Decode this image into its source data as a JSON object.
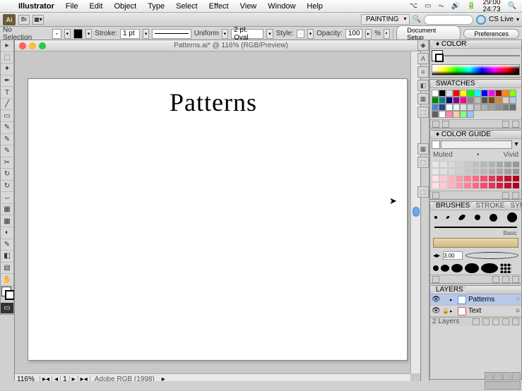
{
  "menubar": {
    "app": "Illustrator",
    "items": [
      "File",
      "Edit",
      "Object",
      "Type",
      "Select",
      "Effect",
      "View",
      "Window",
      "Help"
    ],
    "clock_top": "29:00",
    "clock_bottom": "24:73"
  },
  "appbar": {
    "logo": "Ai",
    "workspace": "PAINTING",
    "cslive": "CS Live"
  },
  "controlbar": {
    "selection": "No Selection",
    "stroke_label": "Stroke:",
    "stroke_value": "1 pt",
    "brush_profile": "Uniform",
    "brush_def": "2 pt. Oval",
    "style_label": "Style:",
    "opacity_label": "Opacity:",
    "opacity_value": "100",
    "pct": "%",
    "doc_setup": "Document Setup",
    "preferences": "Preferences"
  },
  "document": {
    "title": "Patterns.ai* @ 116% (RGB/Preview)",
    "heading": "Patterns",
    "zoom": "116%",
    "page_nav": "1",
    "color_profile": "Adobe RGB (1998)"
  },
  "tools": [
    "▸",
    "⬚",
    "✦",
    "✒",
    "T",
    "╱",
    "▭",
    "✎",
    "✂",
    "↻",
    "▦",
    "◐",
    "◧",
    "▤",
    "⇔",
    "Aa",
    "🔍",
    "✋",
    "⬚"
  ],
  "dock_icons": [
    "◆",
    "A",
    "≡",
    "◧",
    "▦",
    "⬚",
    "⬚",
    "⬚",
    "",
    "▦",
    "⬚"
  ],
  "panels": {
    "color": {
      "tab": "COLOR"
    },
    "swatches": {
      "tab": "SWATCHES",
      "colors": [
        "#ffffff",
        "#000000",
        "#e0e0e0",
        "#ff0000",
        "#ffff00",
        "#00ff00",
        "#00ffff",
        "#0000ff",
        "#ff00ff",
        "#880000",
        "#ff8800",
        "#88ff00",
        "#008800",
        "#008888",
        "#000088",
        "#880088",
        "#ff0088",
        "#888888",
        "#bbbbbb",
        "#555555",
        "#884400",
        "#cc8844",
        "#eeccaa",
        "#aaccee",
        "#4488cc",
        "#224488",
        "#ffffff",
        "#f0f0f0",
        "#e0e0e0",
        "#d0d0d0",
        "#c0c0c0",
        "#b0b0b0",
        "#a0a0a0",
        "#909090",
        "#808080",
        "#707070",
        "#606060",
        "#ffffff",
        "#ff88aa",
        "#ffccaa",
        "#88ff88",
        "#88ccff"
      ]
    },
    "colorguide": {
      "tab": "COLOR GUIDE",
      "muted": "Muted",
      "vivid": "Vivid",
      "grays": [
        "#e8e8e8",
        "#e0e0e0",
        "#d8d8d8",
        "#d0d0d0",
        "#c8c8c8",
        "#c0c0c0",
        "#b8b8b8",
        "#b0b0b0",
        "#a8a8a8",
        "#a0a0a0",
        "#989898"
      ],
      "reds": [
        "#ffe0e4",
        "#ffc8d0",
        "#ffb0bc",
        "#ff98a8",
        "#ff8094",
        "#ff6880",
        "#f0506c",
        "#e03858",
        "#d02044",
        "#c01030",
        "#b0001c"
      ]
    },
    "brushes": {
      "tabs": [
        "BRUSHES",
        "STROKE",
        "SYMBOLS"
      ],
      "basic": "Basic",
      "size": "3.00"
    },
    "layers": {
      "tab": "LAYERS",
      "items": [
        {
          "name": "Patterns",
          "visible": true,
          "selected": true,
          "color": "#5a8ad8"
        },
        {
          "name": "Text",
          "visible": true,
          "selected": false,
          "color": "#d85a5a"
        }
      ],
      "footer": "2 Layers"
    }
  }
}
